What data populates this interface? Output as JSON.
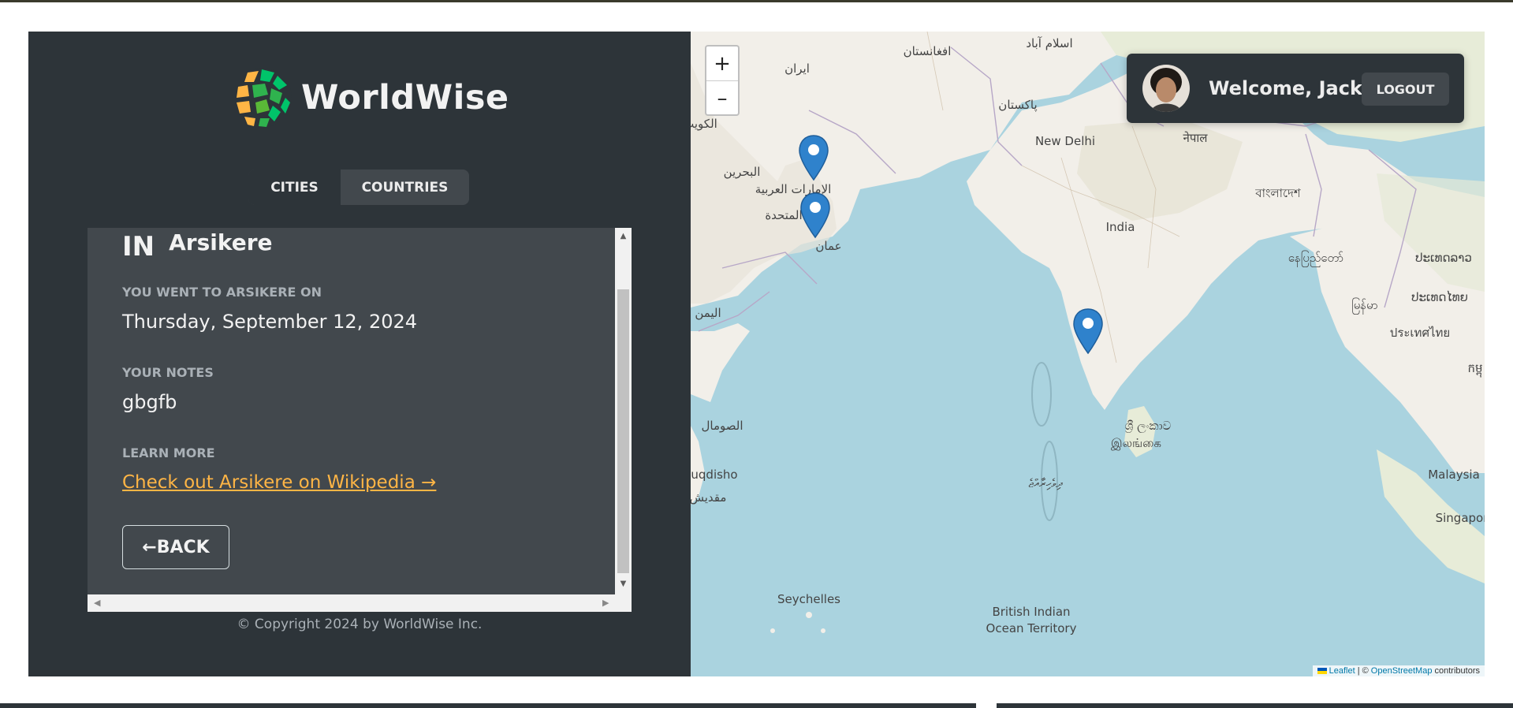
{
  "app": {
    "name": "WorldWise"
  },
  "tabs": [
    {
      "label": "Cities",
      "active": true
    },
    {
      "label": "Countries",
      "active": false
    }
  ],
  "city": {
    "country_code": "IN",
    "name": "Arsikere",
    "visited_label": "You went to Arsikere on",
    "visited_date": "Thursday, September 12, 2024",
    "notes_label": "Your notes",
    "notes": "gbgfb",
    "learn_label": "Learn more",
    "wiki_link": "Check out Arsikere on Wikipedia →",
    "back_label": "←BACK"
  },
  "footer": {
    "copyright": "© Copyright 2024 by WorldWise Inc."
  },
  "map": {
    "zoom_in": "+",
    "zoom_out": "–",
    "user": {
      "welcome": "Welcome, Jack",
      "logout": "LOGOUT"
    },
    "attribution": {
      "leaflet": "Leaflet",
      "separator": "| ©",
      "osm": "OpenStreetMap",
      "suffix": "contributors"
    },
    "labels": {
      "afghanistan": "افغانستان",
      "islamabad": "اسلام آباد",
      "iran": "ایران",
      "pakistan": "پاکستان",
      "kuwait": "الكويت",
      "bahrain": "البحرين",
      "uae1": "الإمارات العربية",
      "uae2": "المتحدة",
      "oman": "عمان",
      "yemen": "اليمن",
      "somalia": "الصومال",
      "mogadishu_en": "uqdisho",
      "mogadishu_ar": "مقديش",
      "new_delhi": "New Delhi",
      "nepal": "नेपाल",
      "bangladesh": "বাংলাদেশ",
      "india": "India",
      "myanmar1": "နေပြည်တော်",
      "myanmar2": "မြန်မာ",
      "laos": "ປະເທດລາວ",
      "thailand1": "ປະເທດໄທຍ",
      "thailand2": "ประเทศไทย",
      "cambodia": "កម្ពុ",
      "sri_lanka_si": "ශ්‍රී ලංකාව",
      "sri_lanka_ta": "இலங்கை",
      "maldives": "ދިވެހިރާއްޖެ",
      "seychelles": "Seychelles",
      "biot1": "British Indian",
      "biot2": "Ocean Territory",
      "malaysia": "Malaysia",
      "singapore": "Singapor"
    }
  }
}
